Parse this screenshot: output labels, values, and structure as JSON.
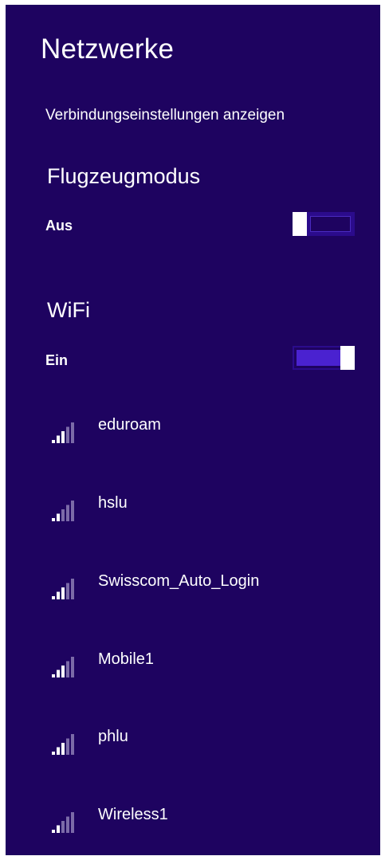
{
  "panel": {
    "title": "Netzwerke",
    "settings_link": "Verbindungseinstellungen anzeigen"
  },
  "airplane": {
    "title": "Flugzeugmodus",
    "state_label": "Aus",
    "enabled": false
  },
  "wifi": {
    "title": "WiFi",
    "state_label": "Ein",
    "enabled": true,
    "networks": [
      {
        "name": "eduroam",
        "signal_bars": 3,
        "signal_max": 5
      },
      {
        "name": "hslu",
        "signal_bars": 2,
        "signal_max": 5
      },
      {
        "name": "Swisscom_Auto_Login",
        "signal_bars": 3,
        "signal_max": 5
      },
      {
        "name": "Mobile1",
        "signal_bars": 3,
        "signal_max": 5
      },
      {
        "name": "phlu",
        "signal_bars": 3,
        "signal_max": 5
      },
      {
        "name": "Wireless1",
        "signal_bars": 2,
        "signal_max": 5
      }
    ]
  },
  "colors": {
    "background": "#1e0360",
    "text": "#ffffff",
    "accent": "#4a22d0",
    "signal_inactive": "#7b6aa8"
  }
}
